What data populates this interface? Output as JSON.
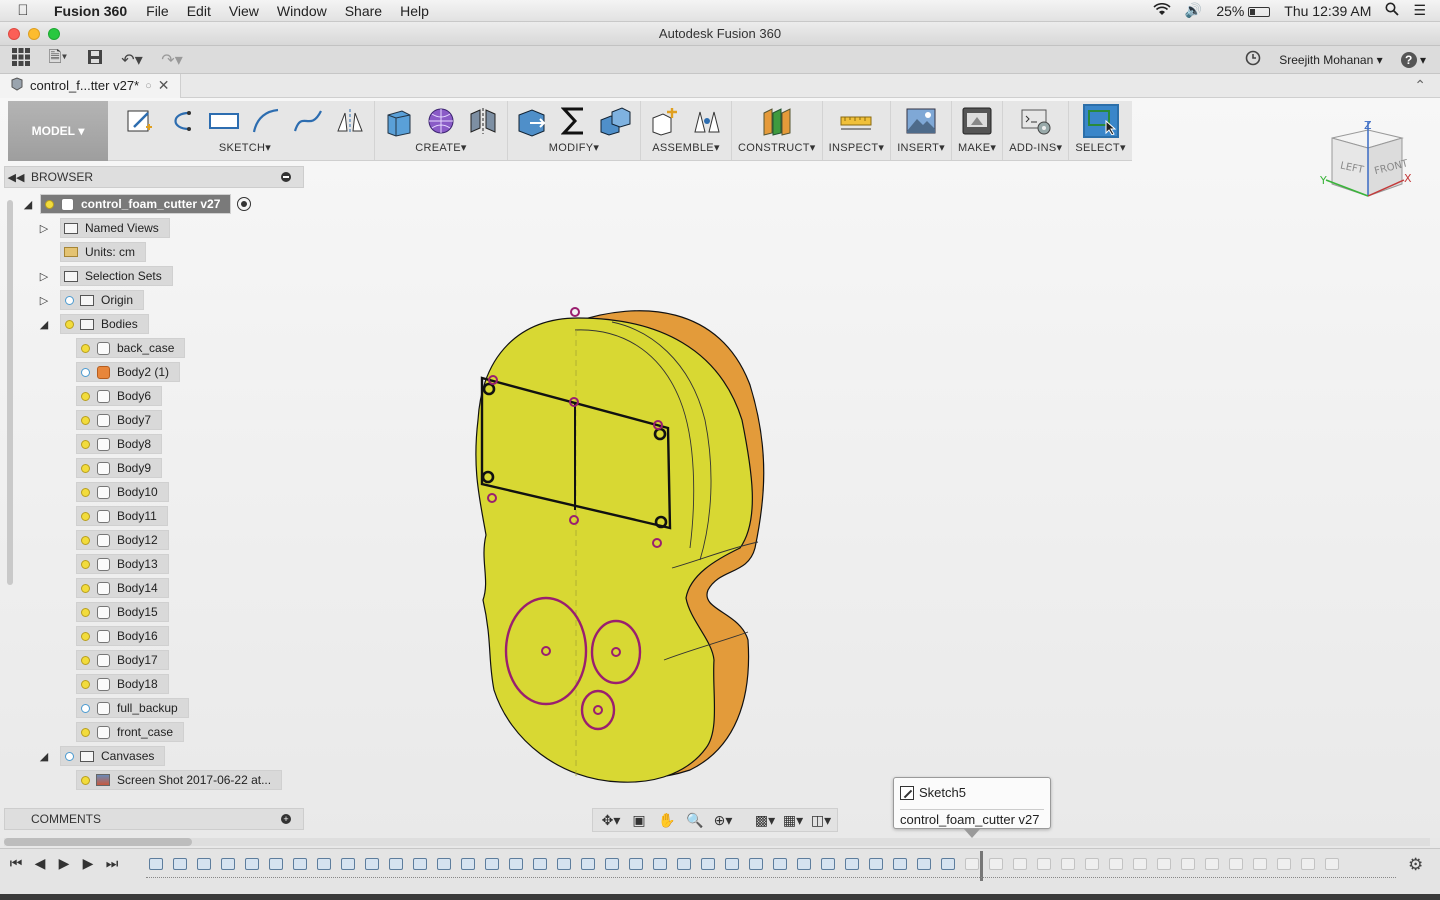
{
  "menubar": {
    "app_name": "Fusion 360",
    "menus": [
      "File",
      "Edit",
      "View",
      "Window",
      "Share",
      "Help"
    ],
    "battery_percent": "25%",
    "battery_level": 0.25,
    "clock": "Thu 12:39 AM"
  },
  "window": {
    "title": "Autodesk Fusion 360"
  },
  "quick_access": {
    "user_name": "Sreejith Mohanan"
  },
  "document_tab": {
    "label": "control_f...tter v27*"
  },
  "toolbar": {
    "workspace": "MODEL",
    "groups": {
      "sketch": "SKETCH",
      "create": "CREATE",
      "modify": "MODIFY",
      "assemble": "ASSEMBLE",
      "construct": "CONSTRUCT",
      "inspect": "INSPECT",
      "insert": "INSERT",
      "make": "MAKE",
      "addins": "ADD-INS",
      "select": "SELECT"
    }
  },
  "viewcube": {
    "left": "LEFT",
    "front": "FRONT",
    "x": "X",
    "y": "Y",
    "z": "Z"
  },
  "browser": {
    "title": "BROWSER",
    "root": "control_foam_cutter v27",
    "items": {
      "named_views": "Named Views",
      "units": "Units: cm",
      "selection_sets": "Selection Sets",
      "origin": "Origin",
      "bodies": "Bodies",
      "canvases": "Canvases"
    },
    "bodies": [
      "back_case",
      "Body2 (1)",
      "Body6",
      "Body7",
      "Body8",
      "Body9",
      "Body10",
      "Body11",
      "Body12",
      "Body13",
      "Body14",
      "Body15",
      "Body16",
      "Body17",
      "Body18",
      "full_backup",
      "front_case"
    ],
    "canvas_item": "Screen Shot 2017-06-22 at..."
  },
  "comments": {
    "title": "COMMENTS"
  },
  "tooltip": {
    "title": "Sketch5",
    "subtitle": "control_foam_cutter v27"
  },
  "colors": {
    "body_yellow": "#d8d833",
    "body_orange": "#e39b3a",
    "sketch_magenta": "#9a1f6f",
    "accent_blue": "#3a86c9"
  }
}
